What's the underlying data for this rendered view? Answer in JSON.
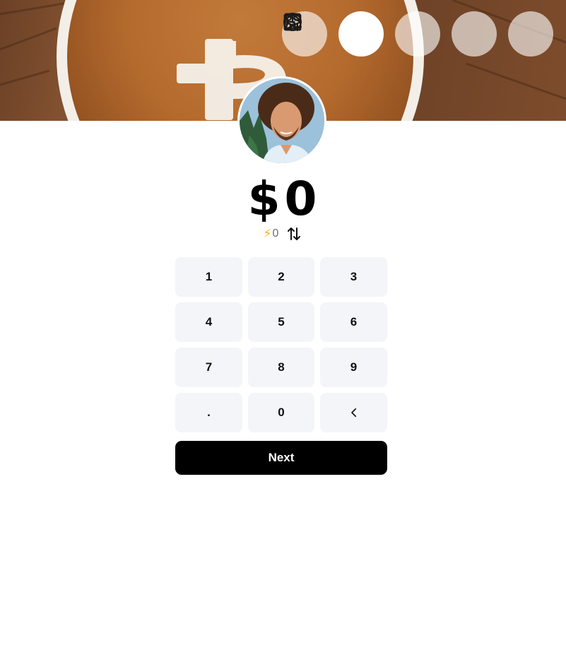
{
  "nav": {
    "items": [
      {
        "id": "home",
        "icon": "home-icon"
      },
      {
        "id": "apps",
        "icon": "apps-add-icon",
        "active": true
      },
      {
        "id": "history",
        "icon": "clock-icon"
      },
      {
        "id": "send",
        "icon": "send-icon"
      },
      {
        "id": "menu",
        "icon": "menu-icon"
      }
    ]
  },
  "banner": {
    "image": "coffee-bitcoin-banner"
  },
  "profile": {
    "avatar": "profile-avatar"
  },
  "amount": {
    "currency": "$",
    "value": "0"
  },
  "sats": {
    "icon": "lightning-icon",
    "value": "0"
  },
  "keypad": {
    "keys": [
      "1",
      "2",
      "3",
      "4",
      "5",
      "6",
      "7",
      "8",
      "9",
      ".",
      "0"
    ],
    "backspace_icon": "chevron-left-icon"
  },
  "actions": {
    "next_label": "Next"
  },
  "colors": {
    "button": "#000000",
    "key_bg": "#f4f5f9",
    "bolt": "#f2b316"
  }
}
